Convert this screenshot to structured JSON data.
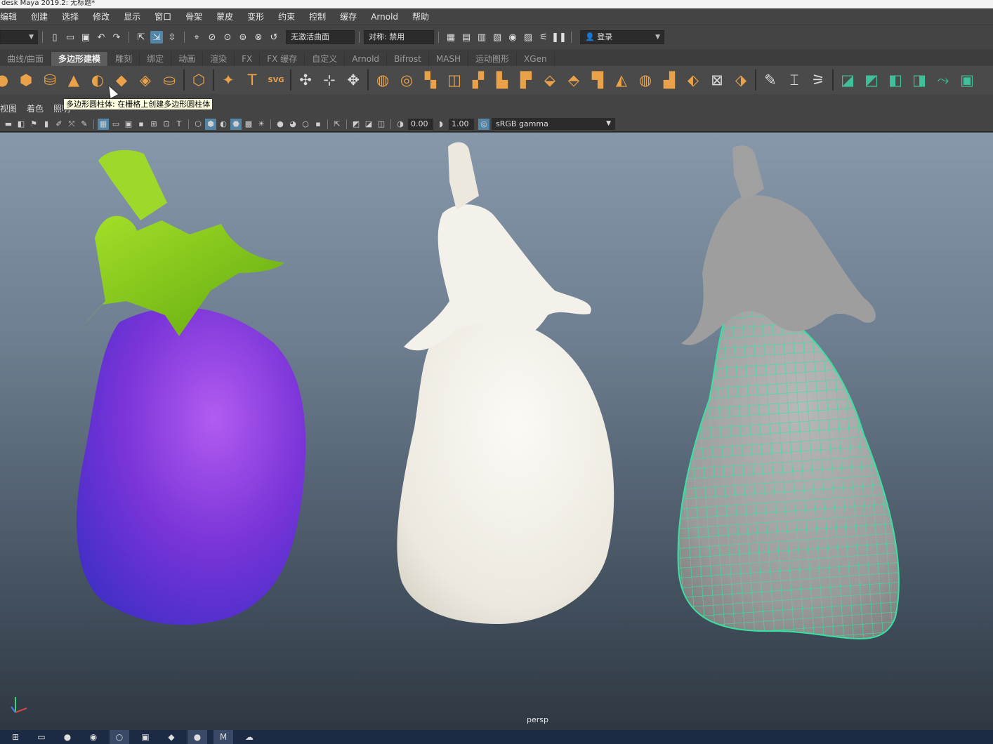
{
  "title": "desk Maya 2019.2: 无标题*",
  "menu": [
    "编辑",
    "创建",
    "选择",
    "修改",
    "显示",
    "窗口",
    "骨架",
    "蒙皮",
    "变形",
    "约束",
    "控制",
    "缓存",
    "Arnold",
    "帮助"
  ],
  "status_line": {
    "live_surface": "无激活曲面",
    "symmetry": "对称: 禁用",
    "login": "登录"
  },
  "shelf_tabs": [
    "曲线/曲面",
    "多边形建模",
    "雕刻",
    "绑定",
    "动画",
    "渲染",
    "FX",
    "FX 缓存",
    "自定义",
    "Arnold",
    "Bifrost",
    "MASH",
    "运动图形",
    "XGen"
  ],
  "active_shelf_tab": "多边形建模",
  "shelf_text_icon": "T",
  "shelf_svg_icon": "SVG",
  "tooltip": "多边形圆柱体: 在栅格上创建多边形圆柱体",
  "panel_menu": [
    "视图",
    "着色",
    "照明"
  ],
  "panel_toolbar": {
    "exposure": "0.00",
    "gamma": "1.00",
    "color_space": "sRGB gamma"
  },
  "viewport": {
    "camera": "persp",
    "models": [
      {
        "name": "eggplant-textured",
        "body_color": "#7a34d8",
        "cap_color": "#86c61c"
      },
      {
        "name": "eggplant-white-clay",
        "body_color": "#efece4"
      },
      {
        "name": "eggplant-wireframe",
        "body_color": "#9b9b9b",
        "wire_color": "#35e3a0"
      }
    ]
  },
  "colors": {
    "highlight": "#5285a6",
    "shelf_icon": "#e9a24a",
    "wire": "#35e3a0"
  }
}
